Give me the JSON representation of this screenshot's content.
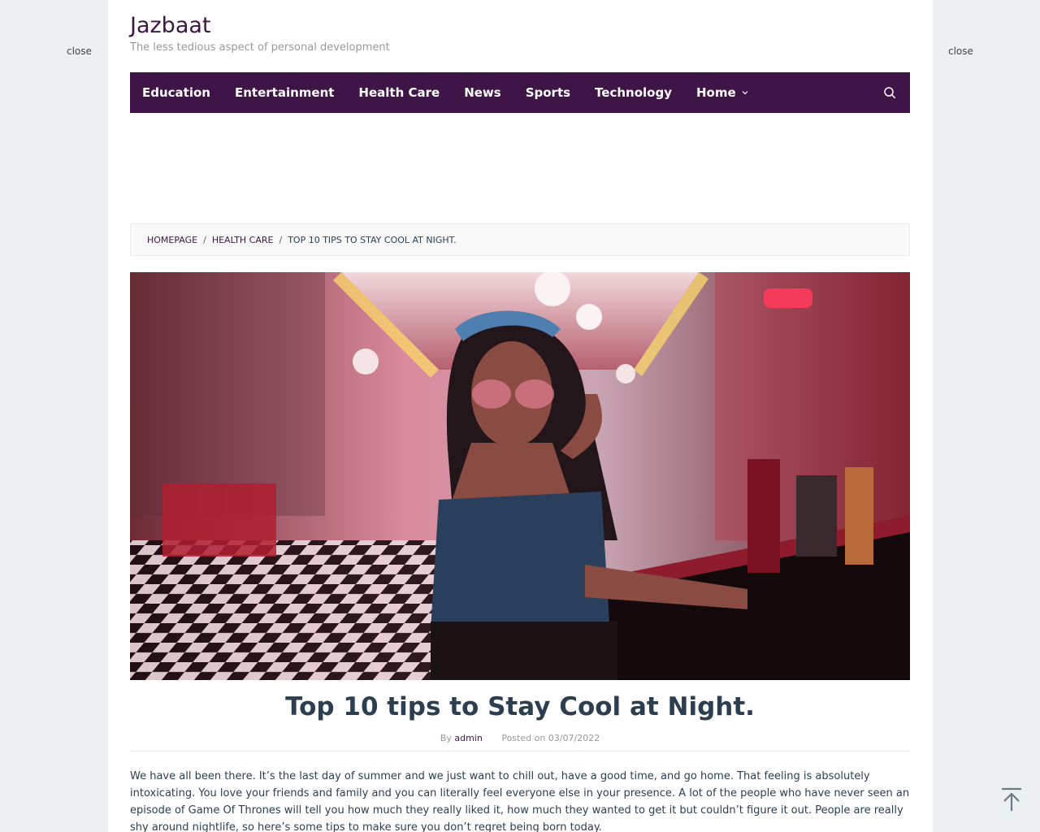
{
  "side_ads": {
    "close_left": "close",
    "close_right": "close"
  },
  "site": {
    "title": "Jazbaat",
    "tagline": "The less tedious aspect of personal development"
  },
  "nav": {
    "items": [
      {
        "label": "Education"
      },
      {
        "label": "Entertainment"
      },
      {
        "label": "Health Care"
      },
      {
        "label": "News"
      },
      {
        "label": "Sports"
      },
      {
        "label": "Technology"
      },
      {
        "label": "Home"
      }
    ],
    "search_icon": "search-icon",
    "dropdown_icon": "chevron-down-icon"
  },
  "breadcrumb": {
    "home": "HOMEPAGE",
    "category": "HEALTH CARE",
    "current": "TOP 10 TIPS TO STAY COOL AT NIGHT.",
    "separator": "/"
  },
  "post": {
    "title": "Top 10 tips to Stay Cool at Night.",
    "by_label": "By",
    "author": "admin",
    "posted_label": "Posted on",
    "date": "03/07/2022",
    "body": "We have all been there. It’s the last day of summer and we just want to chill out, have a good time, and go home. That feeling is absolutely intoxicating. You love your friends and family and you can literally feel everyone else in your presence. A lot of the people who have never seen an episode of Game Of Thrones will tell you how much they really liked it, how much they wanted to get it but couldn’t figure it out. People are really shy around nightlife, so here’s some tips to make sure you don’t regret being born today."
  },
  "back_to_top_icon": "arrow-up-to-top-icon",
  "colors": {
    "brand": "#3f1447",
    "page_bg": "#edf0f0",
    "text": "#2c3e50",
    "muted": "#999999"
  }
}
